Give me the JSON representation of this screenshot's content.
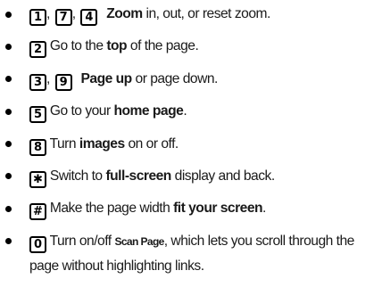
{
  "items": [
    {
      "keys": [
        "1",
        "7",
        "4"
      ],
      "bold": "Zoom",
      "after": " in, out, or reset zoom."
    },
    {
      "keys": [
        "2"
      ],
      "before": "Go to the ",
      "bold": "top",
      "after": " of the page."
    },
    {
      "keys": [
        "3",
        "9"
      ],
      "bold": "Page up",
      "after": " or page down."
    },
    {
      "keys": [
        "5"
      ],
      "before": "Go to your ",
      "bold": "home page",
      "after": "."
    },
    {
      "keys": [
        "8"
      ],
      "before": "Turn ",
      "bold": "images",
      "after": " on or off."
    },
    {
      "keys": [
        "✱"
      ],
      "before": "Switch to ",
      "bold": "full-screen",
      "after": " display and back."
    },
    {
      "keys": [
        "#"
      ],
      "before": "Make the page width ",
      "bold": "fit your screen",
      "after": "."
    },
    {
      "keys": [
        "0"
      ],
      "before": "Turn on/off ",
      "bold": "Scan Page",
      "after": ", which lets you scroll through the page without highlighting links."
    }
  ],
  "separator": ","
}
